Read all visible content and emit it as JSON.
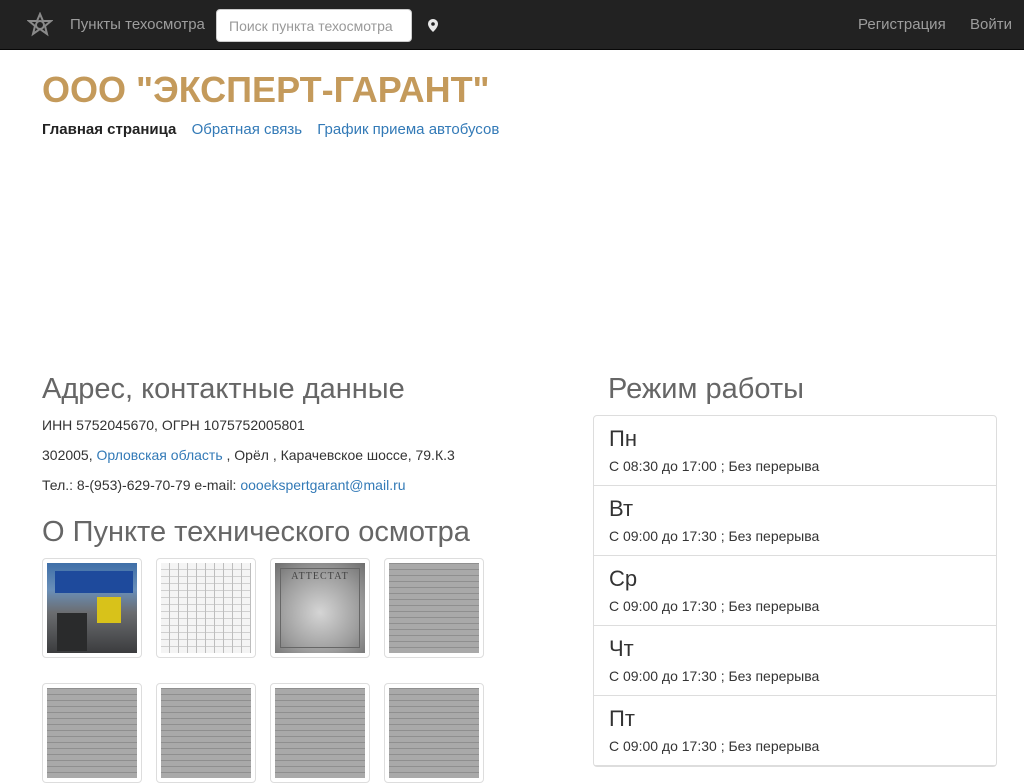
{
  "navbar": {
    "brand": "Пункты техосмотра",
    "search_placeholder": "Поиск пункта техосмотра",
    "register": "Регистрация",
    "login": "Войти"
  },
  "header": {
    "title": "ООО \"ЭКСПЕРТ-ГАРАНТ\"",
    "nav": [
      "Главная страница",
      "Обратная связь",
      "График приема автобусов"
    ]
  },
  "contacts": {
    "heading": "Адрес, контактные данные",
    "inn_ogrn": "ИНН 5752045670, ОГРН 1075752005801",
    "postal_code": "302005,",
    "region": "Орловская область",
    "address_rest": ", Орёл , Карачевское шоссе, 79.К.3",
    "phone_label": "Тел.: 8-(953)-629-70-79 e-mail:",
    "email": "oooekspertgarant@mail.ru"
  },
  "about": {
    "heading": "О Пункте технического осмотра",
    "photo_sign_text": "Пункт технического осмотра",
    "certificate_text": "АТТЕСТАТ"
  },
  "schedule": {
    "heading": "Режим работы",
    "days": [
      {
        "day": "Пн",
        "hours": "С 08:30 до 17:00 ; Без перерыва"
      },
      {
        "day": "Вт",
        "hours": "С 09:00 до 17:30 ; Без перерыва"
      },
      {
        "day": "Ср",
        "hours": "С 09:00 до 17:30 ; Без перерыва"
      },
      {
        "day": "Чт",
        "hours": "С 09:00 до 17:30 ; Без перерыва"
      },
      {
        "day": "Пт",
        "hours": "С 09:00 до 17:30 ; Без перерыва"
      }
    ]
  },
  "colors": {
    "navbar_bg": "#222222",
    "title_gold": "#c49a5b",
    "link": "#337ab7"
  }
}
